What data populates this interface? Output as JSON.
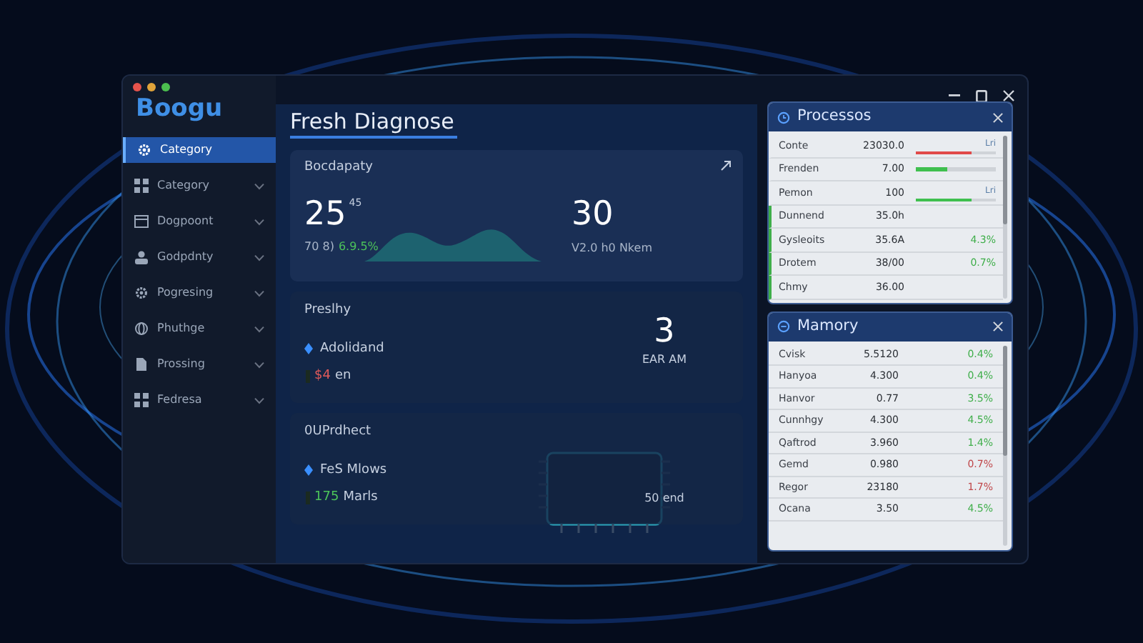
{
  "app": {
    "logo": "Boogu"
  },
  "sidebar": {
    "items": [
      {
        "label": "Category",
        "kind": "gear",
        "selected": true
      },
      {
        "label": "Category",
        "kind": "grid",
        "selected": false
      },
      {
        "label": "Dogpoont",
        "kind": "window",
        "selected": false
      },
      {
        "label": "Godpdnty",
        "kind": "person",
        "selected": false
      },
      {
        "label": "Pogresing",
        "kind": "gear",
        "selected": false
      },
      {
        "label": "Phuthge",
        "kind": "globe",
        "selected": false
      },
      {
        "label": "Prossing",
        "kind": "doc",
        "selected": false
      },
      {
        "label": "Fedresa",
        "kind": "grid",
        "selected": false
      }
    ]
  },
  "main": {
    "title": "Fresh Diagnose",
    "summary": {
      "title": "Bocdapaty",
      "value": "25",
      "superscript": "45",
      "sub": "70 8)",
      "delta": "6.9.5%",
      "right_value": "30",
      "right_sub": "V2.0 h0 Nkem"
    },
    "cards": [
      {
        "title": "Preslhy",
        "item": "Adolidand",
        "stat": "$4",
        "color": "#e05a5a",
        "stat_label": "en",
        "right_value": "3",
        "right_sub": "EAR AM"
      },
      {
        "title": "0UPrdhect",
        "item": "FeS Mlows",
        "stat": "175",
        "color": "#4cc35a",
        "stat_label": "Marls",
        "right_sub": "50 end"
      }
    ]
  },
  "processes": {
    "title": "Processos",
    "rows": [
      {
        "name": "Conte",
        "value": "23030.0",
        "note": "Lri",
        "bar": {
          "level": 0.7,
          "color": "#e04a4a"
        },
        "highlighted": false
      },
      {
        "name": "Frenden",
        "value": "7.00",
        "bar": {
          "level": 0.4,
          "color": "#3fbf4f"
        },
        "highlighted": false
      },
      {
        "name": "Pemon",
        "value": "100",
        "note": "Lri",
        "bar": {
          "level": 0.7,
          "color": "#3fbf4f"
        },
        "highlighted": false
      },
      {
        "name": "Dunnend",
        "value": "35.0h",
        "highlighted": true
      },
      {
        "name": "Gysleoits",
        "value": "35.6A",
        "change": "4.3%",
        "color": "#3fae4a",
        "highlighted": true
      },
      {
        "name": "Drotem",
        "value": "38/00",
        "change": "0.7%",
        "color": "#3fae4a",
        "highlighted": true
      },
      {
        "name": "Chmy",
        "value": "36.00",
        "highlighted": true
      }
    ]
  },
  "memory": {
    "title": "Mamory",
    "rows": [
      {
        "name": "Cvisk",
        "value": "5.5120",
        "change": "0.4%",
        "color": "#3fae4a"
      },
      {
        "name": "Hanyoa",
        "value": "4.300",
        "change": "0.4%",
        "color": "#3fae4a"
      },
      {
        "name": "Hanvor",
        "value": "0.77",
        "change": "3.5%",
        "color": "#3fae4a"
      },
      {
        "name": "Cunnhgy",
        "value": "4.300",
        "change": "4.5%",
        "color": "#3fae4a"
      },
      {
        "name": "Qaftrod",
        "value": "3.960",
        "change": "1.4%",
        "color": "#3fae4a"
      },
      {
        "name": "Gemd",
        "value": "0.980",
        "change": "0.7%",
        "color": "#c0474a"
      },
      {
        "name": "Regor",
        "value": "23180",
        "change": "1.7%",
        "color": "#c0474a"
      },
      {
        "name": "Ocana",
        "value": "3.50",
        "change": "4.5%",
        "color": "#3fae4a"
      }
    ]
  }
}
